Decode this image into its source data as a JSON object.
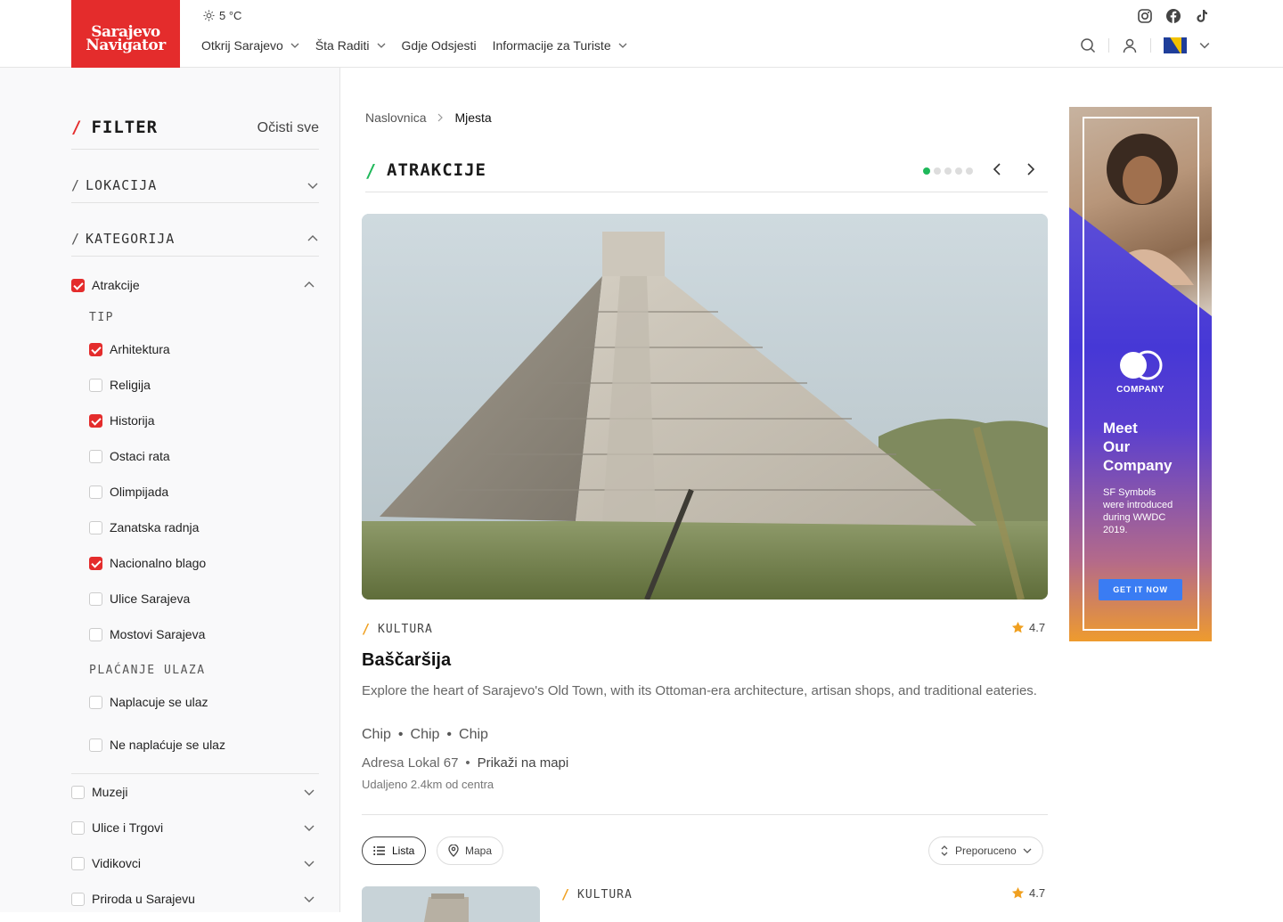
{
  "header": {
    "logo_line1": "Sarajevo",
    "logo_line2": "Navigator",
    "weather": "5 °C",
    "nav": [
      {
        "label": "Otkrij Sarajevo",
        "dropdown": true
      },
      {
        "label": "Šta Raditi",
        "dropdown": true
      },
      {
        "label": "Gdje Odsjesti",
        "dropdown": false
      },
      {
        "label": "Informacije za Turiste",
        "dropdown": true
      }
    ],
    "social": [
      "instagram-icon",
      "facebook-icon",
      "tiktok-icon"
    ]
  },
  "filter": {
    "title": "FILTER",
    "clear_label": "Očisti sve",
    "sections": {
      "lokacija": "LOKACIJA",
      "kategorija": "KATEGORIJA"
    },
    "atrakcije_label": "Atrakcije",
    "tip_label": "TIP",
    "tip_items": [
      {
        "label": "Arhitektura",
        "checked": true
      },
      {
        "label": "Religija",
        "checked": false
      },
      {
        "label": "Historija",
        "checked": true
      },
      {
        "label": "Ostaci rata",
        "checked": false
      },
      {
        "label": "Olimpijada",
        "checked": false
      },
      {
        "label": "Zanatska radnja",
        "checked": false
      },
      {
        "label": "Nacionalno blago",
        "checked": true
      },
      {
        "label": "Ulice Sarajeva",
        "checked": false
      },
      {
        "label": "Mostovi Sarajeva",
        "checked": false
      }
    ],
    "placanje_label": "PLAĆANJE ULAZA",
    "placanje_items": [
      {
        "label": "Naplacuje se ulaz",
        "checked": false
      },
      {
        "label": "Ne naplaćuje se ulaz",
        "checked": false
      }
    ],
    "categories": [
      {
        "label": "Muzeji",
        "checked": false
      },
      {
        "label": "Ulice i Trgovi",
        "checked": false
      },
      {
        "label": "Vidikovci",
        "checked": false
      },
      {
        "label": "Priroda u Sarajevu",
        "checked": false
      }
    ]
  },
  "breadcrumb": {
    "home": "Naslovnica",
    "current": "Mjesta"
  },
  "section": {
    "title": "ATRAKCIJE",
    "slides": 5,
    "active_slide": 1
  },
  "featured": {
    "tag": "KULTURA",
    "rating": "4.7",
    "title": "Baščaršija",
    "description": "Explore the heart of Sarajevo's Old Town, with its Ottoman-era architecture, artisan shops, and traditional eateries.",
    "chips": [
      "Chip",
      "Chip",
      "Chip"
    ],
    "address": "Adresa Lokal 67",
    "map_link": "Prikaži na mapi",
    "distance": "Udaljeno 2.4km od centra"
  },
  "view_controls": {
    "list_label": "Lista",
    "map_label": "Mapa",
    "sort_label": "Preporuceno"
  },
  "second_item": {
    "tag": "KULTURA",
    "rating": "4.7"
  },
  "ad": {
    "company": "COMPANY",
    "headline": [
      "Meet",
      "Our",
      "Company"
    ],
    "body": "SF Symbols were introduced during WWDC 2019.",
    "cta": "GET IT NOW"
  },
  "colors": {
    "brand_red": "#e42c2c",
    "accent_green": "#1fb85a",
    "accent_orange": "#f0a020",
    "ad_button": "#3a7cf3"
  }
}
